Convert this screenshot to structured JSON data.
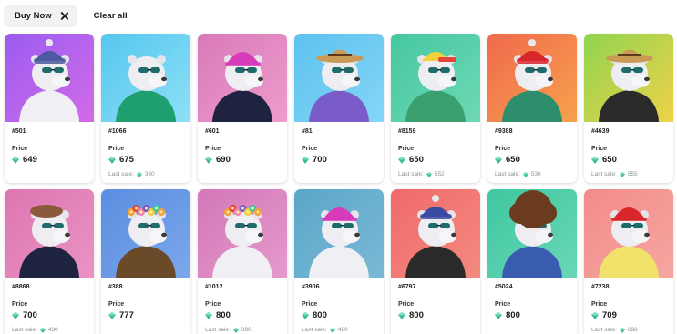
{
  "filters": {
    "chip_label": "Buy Now",
    "clear_label": "Clear all"
  },
  "accent_gem_color": "#3dba9b",
  "price_label": "Price",
  "last_sale_label": "Last sale:",
  "cards": [
    {
      "token": "#501",
      "price": "649",
      "last_sale": "",
      "bg": "#9b5cf0",
      "bg2": "#d26be8",
      "hat": "beanie",
      "hat_color": "#4b5aa0",
      "top_color": "#f0f0f4"
    },
    {
      "token": "#1066",
      "price": "675",
      "last_sale": "360",
      "bg": "#55c6ee",
      "bg2": "#8ee0f7",
      "hat": "none",
      "hat_color": "#6b3b1f",
      "top_color": "#1f9e6f"
    },
    {
      "token": "#601",
      "price": "690",
      "last_sale": "",
      "bg": "#d97ab8",
      "bg2": "#ee9ccd",
      "hat": "helmet",
      "hat_color": "#d83bb9",
      "top_color": "#1e2440"
    },
    {
      "token": "#81",
      "price": "700",
      "last_sale": "",
      "bg": "#5cc1ef",
      "bg2": "#86d6f6",
      "hat": "straw",
      "hat_color": "#c99a55",
      "top_color": "#7a5cc8"
    },
    {
      "token": "#8159",
      "price": "650",
      "last_sale": "552",
      "bg": "#45c7a0",
      "bg2": "#6fd8b6",
      "hat": "cap",
      "hat_color": "#f2d23a",
      "top_color": "#3aa070"
    },
    {
      "token": "#9388",
      "price": "650",
      "last_sale": "530",
      "bg": "#f06a4c",
      "bg2": "#f7a14e",
      "hat": "beanie",
      "hat_color": "#d8262b",
      "top_color": "#2e8e6b"
    },
    {
      "token": "#4639",
      "price": "650",
      "last_sale": "555",
      "bg": "#8fd44f",
      "bg2": "#f0d24a",
      "hat": "straw",
      "hat_color": "#c99a55",
      "top_color": "#2a2a2a"
    },
    {
      "token": "#8868",
      "price": "700",
      "last_sale": "430",
      "bg": "#dd76b2",
      "bg2": "#ea93c4",
      "hat": "beret",
      "hat_color": "#8a5a3a",
      "top_color": "#1e2440"
    },
    {
      "token": "#388",
      "price": "777",
      "last_sale": "",
      "bg": "#5b8de0",
      "bg2": "#7aa8ec",
      "hat": "flowers",
      "hat_color": "#f08ab0",
      "top_color": "#6b4a2a"
    },
    {
      "token": "#1012",
      "price": "800",
      "last_sale": "390",
      "bg": "#d377b8",
      "bg2": "#e59acb",
      "hat": "flowers",
      "hat_color": "#f2a23a",
      "top_color": "#f0f0f4"
    },
    {
      "token": "#3906",
      "price": "800",
      "last_sale": "480",
      "bg": "#5aa6c8",
      "bg2": "#7ab9d6",
      "hat": "helmet",
      "hat_color": "#d83bb9",
      "top_color": "#f0f0f4"
    },
    {
      "token": "#6797",
      "price": "800",
      "last_sale": "",
      "bg": "#f06a6a",
      "bg2": "#f38a7f",
      "hat": "beanie",
      "hat_color": "#3a4aa0",
      "top_color": "#2a2a2a"
    },
    {
      "token": "#5024",
      "price": "800",
      "last_sale": "",
      "bg": "#3fc7a0",
      "bg2": "#6ad7b6",
      "hat": "afro",
      "hat_color": "#6b3b1f",
      "top_color": "#3a5cb0"
    },
    {
      "token": "#7238",
      "price": "709",
      "last_sale": "698",
      "bg": "#f28c8c",
      "bg2": "#f6a6a0",
      "hat": "helmet",
      "hat_color": "#d8262b",
      "top_color": "#f0e26a"
    }
  ]
}
